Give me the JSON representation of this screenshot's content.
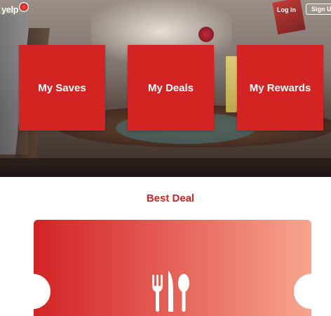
{
  "header": {
    "logo_text": "yelp",
    "login_label": "Log In",
    "signup_label": "Sign Up"
  },
  "tiles": [
    {
      "label": "My Saves"
    },
    {
      "label": "My Deals"
    },
    {
      "label": "My Rewards"
    }
  ],
  "best_deal": {
    "title": "Best Deal",
    "icon": "fork-knife-spoon-icon"
  },
  "colors": {
    "brand_red": "#d32323",
    "ticket_gradient_end": "#f7a58f"
  }
}
